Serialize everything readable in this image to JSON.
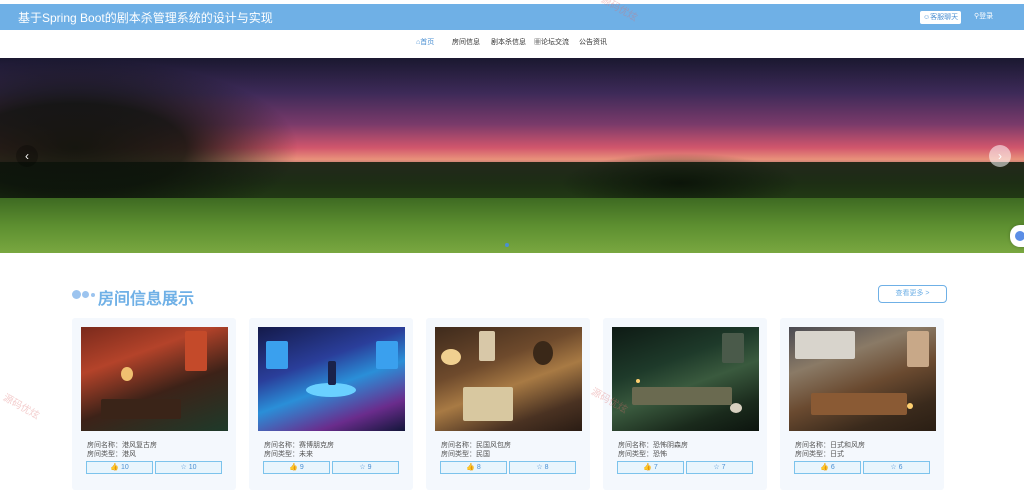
{
  "header": {
    "title": "基于Spring Boot的剧本杀管理系统的设计与实现",
    "service_btn": "☺客服聊天",
    "login_btn": "登录"
  },
  "nav": {
    "items": [
      {
        "label": "首页",
        "active": true
      },
      {
        "label": "房间信息",
        "active": false
      },
      {
        "label": "剧本杀信息",
        "active": false
      },
      {
        "label": "论坛交流",
        "active": false
      },
      {
        "label": "公告资讯",
        "active": false
      }
    ]
  },
  "banner": {
    "prev_icon": "chevron-left-icon",
    "next_icon": "chevron-right-icon"
  },
  "section": {
    "title": "房间信息展示",
    "more_label": "查看更多 >"
  },
  "cards": [
    {
      "name_label": "房间名称：",
      "name": "港风复古房",
      "type_label": "房间类型：",
      "type": "港风",
      "likes": "10",
      "favs": "10"
    },
    {
      "name_label": "房间名称：",
      "name": "赛博朋克房",
      "type_label": "房间类型：",
      "type": "未来",
      "likes": "9",
      "favs": "9"
    },
    {
      "name_label": "房间名称：",
      "name": "民国风包房",
      "type_label": "房间类型：",
      "type": "民国",
      "likes": "8",
      "favs": "8"
    },
    {
      "name_label": "房间名称：",
      "name": "恐怖阴森房",
      "type_label": "房间类型：",
      "type": "恐怖",
      "likes": "7",
      "favs": "7"
    },
    {
      "name_label": "房间名称：",
      "name": "日式和风房",
      "type_label": "房间类型：",
      "type": "日式",
      "likes": "6",
      "favs": "6"
    }
  ],
  "colors": {
    "header_bg": "#6fb0e6",
    "accent": "#4a8fd2",
    "card_bg": "#f4f8fd",
    "stat_border": "#7cc3ec"
  },
  "watermark_text": "源码优炫"
}
